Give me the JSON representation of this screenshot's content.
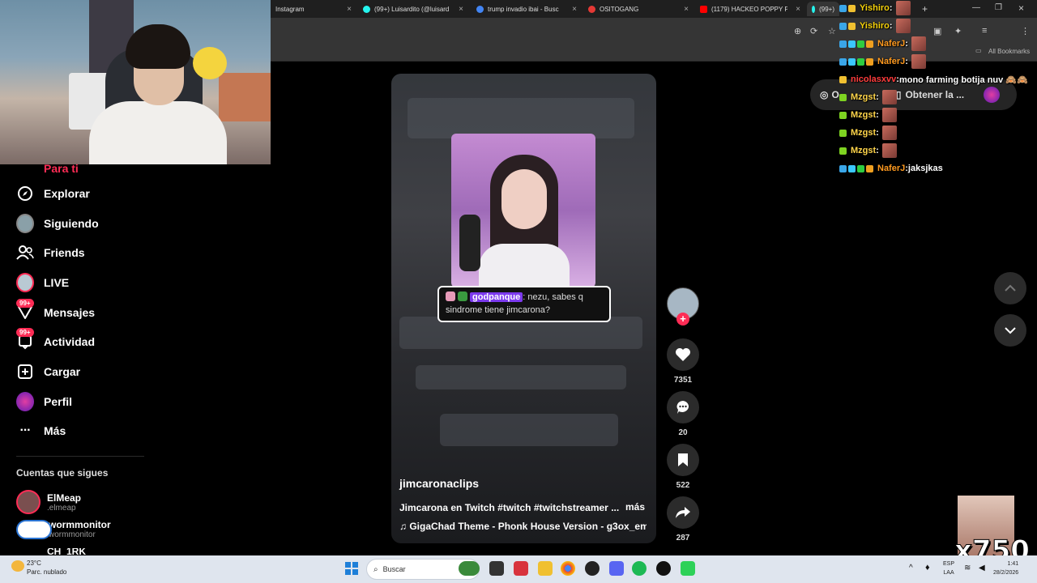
{
  "browser": {
    "tabs": [
      {
        "title": "Instagram",
        "color": "#d6249f"
      },
      {
        "title": "(99+) Luisardito (@luisard",
        "color": "#25f4ee"
      },
      {
        "title": "trump invadio ibai - Busc",
        "color": "#4285f4"
      },
      {
        "title": "OSITOGANG",
        "color": "#e53935"
      },
      {
        "title": "(1179) HACKEO POPPY P",
        "color": "#ff0000"
      },
      {
        "title": "(99+)",
        "color": "#25f4ee"
      }
    ],
    "bookmarks_label": "All Bookmarks"
  },
  "sidebar": {
    "top_partial": "Para ti",
    "items": [
      {
        "label": "Explorar",
        "icon": "compass-icon",
        "badge": ""
      },
      {
        "label": "Siguiendo",
        "icon": "following-avatar-icon",
        "badge": ""
      },
      {
        "label": "Friends",
        "icon": "friends-icon",
        "badge": ""
      },
      {
        "label": "LIVE",
        "icon": "live-avatar-icon",
        "badge": ""
      },
      {
        "label": "Mensajes",
        "icon": "messages-icon",
        "badge": "99+"
      },
      {
        "label": "Actividad",
        "icon": "activity-icon",
        "badge": "99+"
      },
      {
        "label": "Cargar",
        "icon": "upload-icon",
        "badge": ""
      },
      {
        "label": "Perfil",
        "icon": "profile-avatar-icon",
        "badge": ""
      },
      {
        "label": "Más",
        "icon": "more-dots-icon",
        "badge": ""
      }
    ],
    "following_heading": "Cuentas que sigues",
    "following": [
      {
        "name": "ElMeap",
        "handle": ".elmeap"
      },
      {
        "name": "wormmonitor",
        "handle": "wormmonitor"
      },
      {
        "name": "CH_1RK",
        "handle": ""
      }
    ]
  },
  "video": {
    "chat_bubble": {
      "user": "godpanque",
      "text": ": nezu, sabes q sindrome tiene jimcarona?"
    },
    "author": "jimcaronaclips",
    "description": "Jimcarona en Twitch #twitch #twitchstreamer ...",
    "more": "más",
    "music": "GigaChad Theme - Phonk House Version - g3ox_em"
  },
  "actions": {
    "likes": "7351",
    "comments": "20",
    "saves": "522",
    "shares": "287"
  },
  "get_app": "Obtener la ...",
  "get_app_prefix": "O",
  "chat_overlay": [
    {
      "user": "Yishiro",
      "color": "#f5d10b",
      "msg": "",
      "emote": true
    },
    {
      "user": "Yishiro",
      "color": "#f5d10b",
      "msg": "",
      "emote": true
    },
    {
      "user": "NaferJ",
      "color": "#ff9a1f",
      "msg": "",
      "emote": true
    },
    {
      "user": "NaferJ",
      "color": "#ff9a1f",
      "msg": "",
      "emote": true
    },
    {
      "user": "nicolasxvv",
      "color": "#ff3b3b",
      "msg": "mono farming botija nuv 🙈🙈",
      "emote": false
    },
    {
      "user": "Mzgst",
      "color": "#ffd54a",
      "msg": "",
      "emote": true
    },
    {
      "user": "Mzgst",
      "color": "#ffd54a",
      "msg": "",
      "emote": true
    },
    {
      "user": "Mzgst",
      "color": "#ffd54a",
      "msg": "",
      "emote": true
    },
    {
      "user": "Mzgst",
      "color": "#ffd54a",
      "msg": "",
      "emote": true
    },
    {
      "user": "NaferJ",
      "color": "#ff9a1f",
      "msg": "jaksjkas",
      "emote": false
    }
  ],
  "taskbar": {
    "temp": "23°C",
    "weather": "Parc. nublado",
    "search": "Buscar",
    "lang1": "ESP",
    "lang2": "LAA",
    "time": "1:41",
    "date": "28/2/2026"
  },
  "meme_overlay": "x750",
  "colors": {
    "accent": "#fe2c55",
    "background": "#000000"
  }
}
